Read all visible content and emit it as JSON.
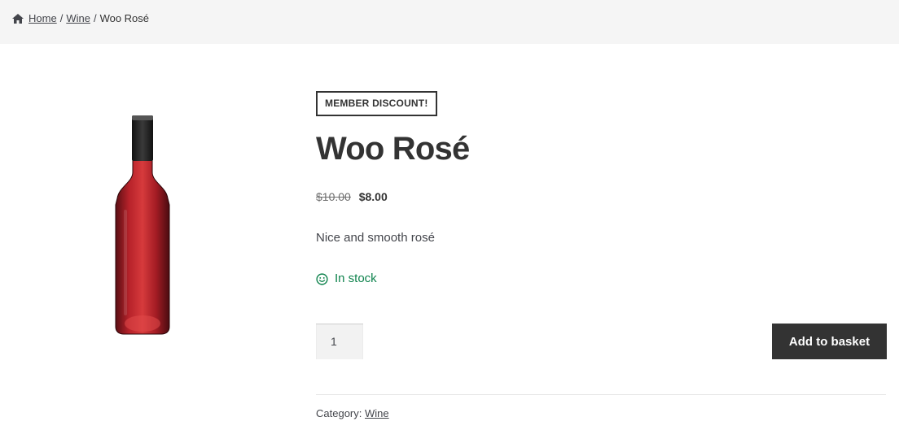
{
  "breadcrumb": {
    "home_label": "Home",
    "category_label": "Wine",
    "current_label": "Woo Rosé",
    "separator": "/"
  },
  "product": {
    "badge": "MEMBER DISCOUNT!",
    "title": "Woo Rosé",
    "old_price": "$10.00",
    "new_price": "$8.00",
    "description": "Nice and smooth rosé",
    "stock_status": "In stock",
    "quantity": "1",
    "add_to_basket_label": "Add to basket",
    "category_prefix": "Category:",
    "category_link": "Wine",
    "image_icon": "wine-bottle"
  },
  "colors": {
    "accent": "#333333",
    "in_stock": "#0f834d",
    "breadcrumb_bg": "#f5f5f5"
  }
}
